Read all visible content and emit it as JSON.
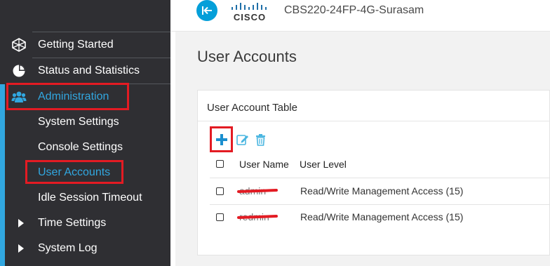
{
  "colors": {
    "sidebar_bg": "#2f2f33",
    "accent_blue": "#31a7e0",
    "highlight_red": "#e31b23",
    "main_bg": "#f2f2f2"
  },
  "header": {
    "brand": "CISCO",
    "device_name": "CBS220-24FP-4G-Surasam"
  },
  "sidebar": {
    "items": [
      {
        "label": "Getting Started",
        "icon": "getting-started-icon"
      },
      {
        "label": "Status and Statistics",
        "icon": "pie-chart-icon"
      },
      {
        "label": "Administration",
        "icon": "users-icon"
      },
      {
        "label": "System Settings"
      },
      {
        "label": "Console Settings"
      },
      {
        "label": "User Accounts"
      },
      {
        "label": "Idle Session Timeout"
      },
      {
        "label": "Time Settings",
        "icon": "chevron-right-icon"
      },
      {
        "label": "System Log",
        "icon": "chevron-right-icon"
      }
    ]
  },
  "main": {
    "page_title": "User Accounts",
    "table": {
      "title": "User Account Table",
      "columns": [
        "User Name",
        "User Level"
      ],
      "rows": [
        {
          "user_name": "admin",
          "user_level": "Read/Write Management Access (15)"
        },
        {
          "user_name": "redmin",
          "user_level": "Read/Write Management Access (15)"
        }
      ]
    }
  }
}
